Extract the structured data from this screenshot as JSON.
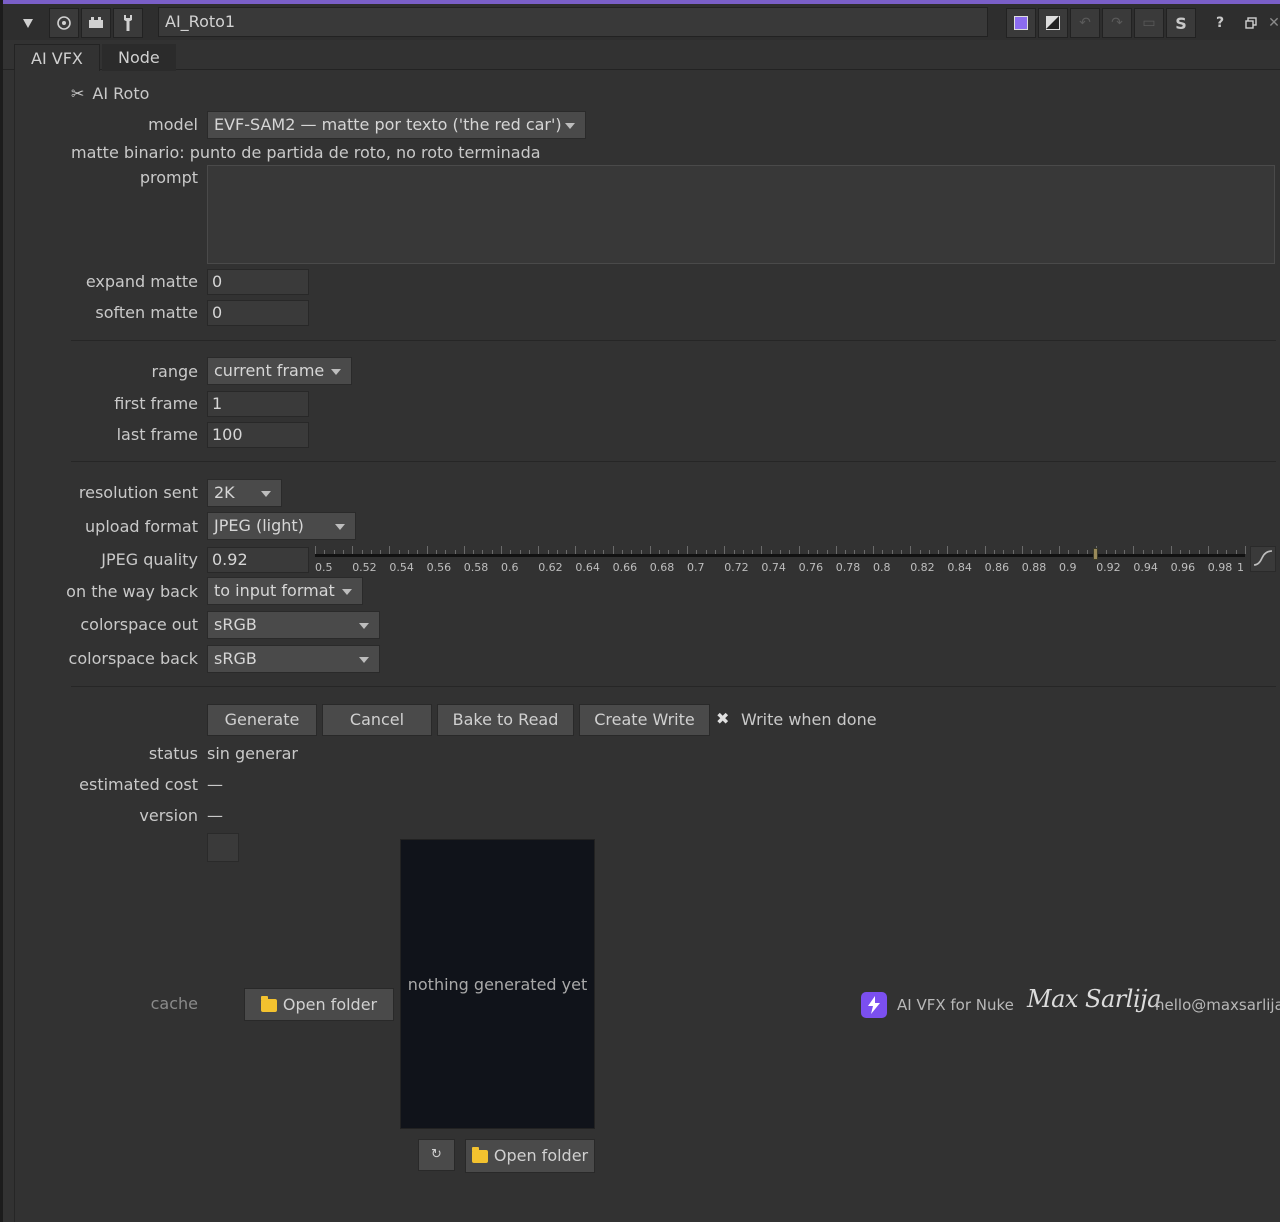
{
  "window": {
    "node_name": "AI_Roto1",
    "tabs": [
      {
        "label": "AI VFX"
      },
      {
        "label": "Node"
      }
    ]
  },
  "section": {
    "icon": "scissors-icon",
    "title": "AI Roto"
  },
  "model": {
    "label": "model",
    "value": "EVF-SAM2 — matte por texto ('the red car')",
    "note": "matte binario: punto de partida de roto, no roto terminada"
  },
  "prompt": {
    "label": "prompt",
    "value": ""
  },
  "expand_matte": {
    "label": "expand matte",
    "value": "0"
  },
  "soften_matte": {
    "label": "soften matte",
    "value": "0"
  },
  "range": {
    "label": "range",
    "value": "current frame"
  },
  "first_frame": {
    "label": "first frame",
    "value": "1"
  },
  "last_frame": {
    "label": "last frame",
    "value": "100"
  },
  "resolution_sent": {
    "label": "resolution sent",
    "value": "2K"
  },
  "upload_format": {
    "label": "upload format",
    "value": "JPEG (light)"
  },
  "jpeg_quality": {
    "label": "JPEG quality",
    "value": "0.92",
    "slider_min": 0.5,
    "slider_max": 1,
    "tick_labels": [
      "0.5",
      "0.52",
      "0.54",
      "0.56",
      "0.58",
      "0.6",
      "0.62",
      "0.64",
      "0.66",
      "0.68",
      "0.7",
      "0.72",
      "0.74",
      "0.76",
      "0.78",
      "0.8",
      "0.82",
      "0.84",
      "0.86",
      "0.88",
      "0.9",
      "0.92",
      "0.94",
      "0.96",
      "0.98",
      "1"
    ]
  },
  "on_the_way_back": {
    "label": "on the way back",
    "value": "to input format"
  },
  "colorspace_out": {
    "label": "colorspace out",
    "value": "sRGB"
  },
  "colorspace_back": {
    "label": "colorspace back",
    "value": "sRGB"
  },
  "actions": {
    "generate": "Generate",
    "cancel": "Cancel",
    "bake_to_read": "Bake to Read",
    "create_write": "Create Write",
    "write_when_done_label": "Write when done",
    "write_when_done_checked": true
  },
  "status": {
    "label": "status",
    "value": "sin generar"
  },
  "estimated_cost": {
    "label": "estimated cost",
    "value": "—"
  },
  "version": {
    "label": "version",
    "value": "—"
  },
  "cache": {
    "label": "cache",
    "open_folder": "Open folder"
  },
  "preview": {
    "empty_text": "nothing generated yet",
    "open_folder": "Open folder",
    "refresh_icon": "refresh-icon"
  },
  "footer": {
    "product": "AI VFX for Nuke",
    "author_signature": "Max Sarlija",
    "email": "hello@maxsarlija"
  },
  "colors": {
    "accent": "#7a5fc8",
    "folder": "#f3c22f",
    "preview_bg": "#10131a",
    "logo": "#7b4ff0"
  }
}
